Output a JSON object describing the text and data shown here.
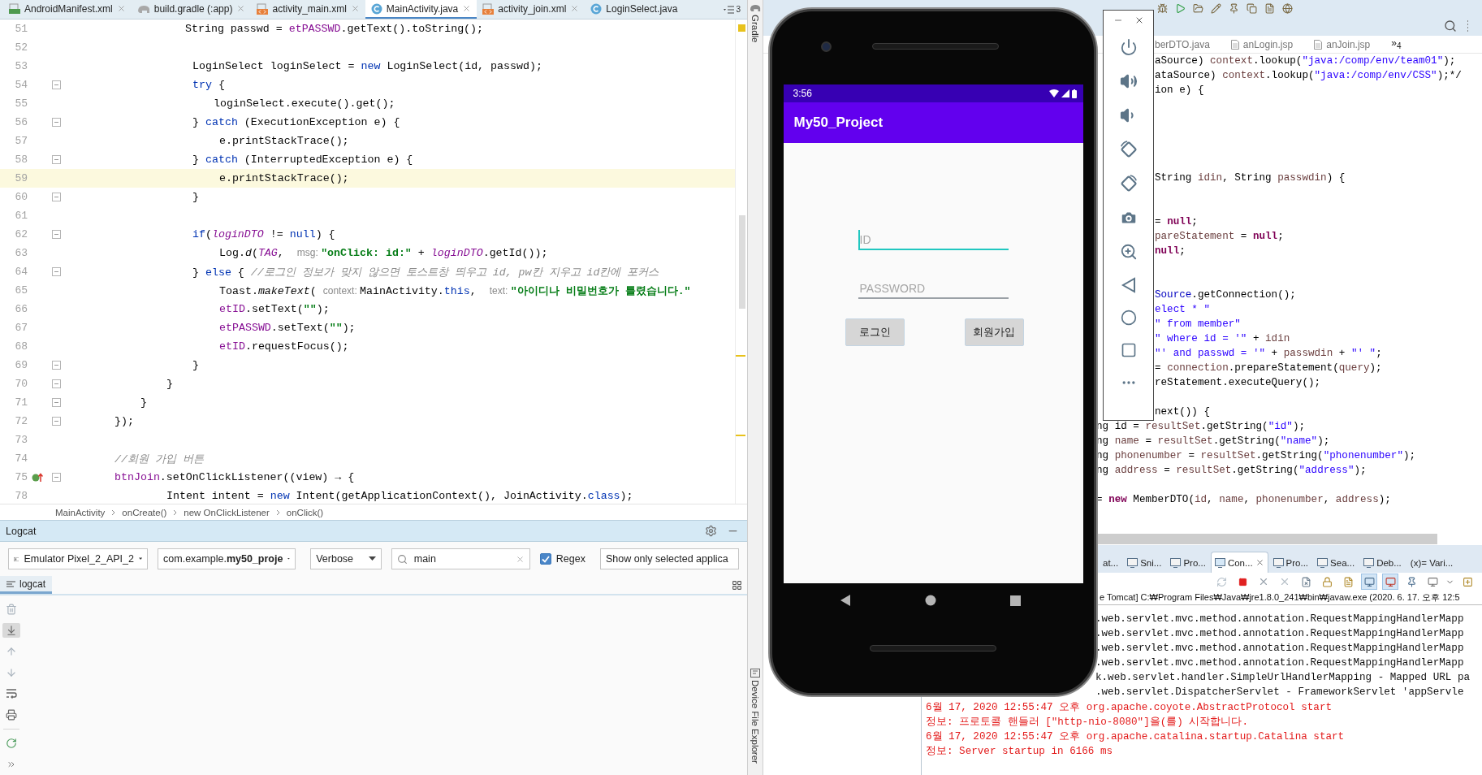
{
  "android_studio": {
    "tabs": [
      {
        "kind": "manifest",
        "label": "AndroidManifest.xml",
        "selected": false,
        "close": true
      },
      {
        "kind": "gradle",
        "label": "build.gradle (:app)",
        "selected": false,
        "close": true
      },
      {
        "kind": "xml",
        "label": "activity_main.xml",
        "selected": false,
        "close": true
      },
      {
        "kind": "class",
        "label": "MainActivity.java",
        "selected": true,
        "close": true
      },
      {
        "kind": "xml",
        "label": "activity_join.xml",
        "selected": false,
        "close": true
      },
      {
        "kind": "class",
        "label": "LoginSelect.java",
        "selected": false,
        "close": false
      }
    ],
    "tab_list_count": "3",
    "code_lines": [
      {
        "num": "51",
        "current": false,
        "fold": false,
        "code": [
          {
            "kind": "plain",
            "text": "String passwd = "
          },
          {
            "kind": "field",
            "text": "etPASSWD"
          },
          {
            "kind": "plain",
            "text": ".getText().toString();"
          }
        ]
      },
      {
        "num": "52",
        "current": false,
        "fold": false
      },
      {
        "num": "53",
        "current": false,
        "fold": false,
        "code": [
          {
            "kind": "plain",
            "text": "LoginSelect loginSelect = "
          },
          {
            "kind": "keyword",
            "text": "new"
          },
          {
            "kind": "plain",
            "text": " LoginSelect(id, passwd);"
          }
        ]
      },
      {
        "num": "54",
        "current": false,
        "fold": true,
        "code": [
          {
            "kind": "keyword",
            "text": "try"
          },
          {
            "kind": "plain",
            "text": " {"
          }
        ]
      },
      {
        "num": "55",
        "current": false,
        "fold": false,
        "code": [
          {
            "kind": "plain",
            "text": "loginSelect.execute().get();"
          }
        ]
      },
      {
        "num": "56",
        "current": false,
        "fold": true,
        "code": [
          {
            "kind": "plain",
            "text": "} "
          },
          {
            "kind": "keyword",
            "text": "catch"
          },
          {
            "kind": "plain",
            "text": " (ExecutionException e) {"
          }
        ]
      },
      {
        "num": "57",
        "current": false,
        "fold": false,
        "code": [
          {
            "kind": "plain",
            "text": "e.printStackTrace();"
          }
        ]
      },
      {
        "num": "58",
        "current": false,
        "fold": true,
        "code": [
          {
            "kind": "plain",
            "text": "} "
          },
          {
            "kind": "keyword",
            "text": "catch"
          },
          {
            "kind": "plain",
            "text": " (InterruptedException e) {"
          }
        ]
      },
      {
        "num": "59",
        "current": true,
        "fold": false,
        "code": [
          {
            "kind": "plain",
            "text": "e.printStackTrace();"
          }
        ]
      },
      {
        "num": "60",
        "current": false,
        "fold": true,
        "code": [
          {
            "kind": "plain",
            "text": "}"
          }
        ]
      },
      {
        "num": "61",
        "current": false,
        "fold": false
      },
      {
        "num": "62",
        "current": false,
        "fold": true,
        "code": [
          {
            "kind": "keyword",
            "text": "if"
          },
          {
            "kind": "plain",
            "text": "("
          },
          {
            "kind": "static_field",
            "text": "loginDTO"
          },
          {
            "kind": "plain",
            "text": " != "
          },
          {
            "kind": "keyword",
            "text": "null"
          },
          {
            "kind": "plain",
            "text": ") {"
          }
        ]
      },
      {
        "num": "63",
        "current": false,
        "fold": false,
        "code": [
          {
            "kind": "plain",
            "text": "Log."
          },
          {
            "kind": "static_method",
            "text": "d"
          },
          {
            "kind": "plain",
            "text": "("
          },
          {
            "kind": "static_field",
            "text": "TAG"
          },
          {
            "kind": "plain",
            "text": ",  "
          },
          {
            "kind": "hint",
            "text": "msg: "
          },
          {
            "kind": "string",
            "text": "\"onClick: id:\""
          },
          {
            "kind": "plain",
            "text": " + "
          },
          {
            "kind": "static_field",
            "text": "loginDTO"
          },
          {
            "kind": "plain",
            "text": ".getId());"
          }
        ]
      },
      {
        "num": "64",
        "current": false,
        "fold": true,
        "code": [
          {
            "kind": "plain",
            "text": "} "
          },
          {
            "kind": "keyword",
            "text": "else"
          },
          {
            "kind": "plain",
            "text": " { "
          },
          {
            "kind": "comment",
            "text": "//로그인 정보가 맞지 않으면 토스트창 띄우고 id, pw칸 지우고 id칸에 포커스"
          }
        ]
      },
      {
        "num": "65",
        "current": false,
        "fold": false,
        "code": [
          {
            "kind": "plain",
            "text": "Toast."
          },
          {
            "kind": "static_method",
            "text": "makeText"
          },
          {
            "kind": "plain",
            "text": "( "
          },
          {
            "kind": "hint",
            "text": "context: "
          },
          {
            "kind": "plain",
            "text": "MainActivity."
          },
          {
            "kind": "keyword",
            "text": "this"
          },
          {
            "kind": "plain",
            "text": ",  "
          },
          {
            "kind": "hint",
            "text": "text: "
          },
          {
            "kind": "string",
            "text": "\"아이디나 비밀번호가 틀렸습니다.\""
          }
        ]
      },
      {
        "num": "66",
        "current": false,
        "fold": false,
        "code": [
          {
            "kind": "field",
            "text": "etID"
          },
          {
            "kind": "plain",
            "text": ".setText("
          },
          {
            "kind": "string",
            "text": "\"\""
          },
          {
            "kind": "plain",
            "text": ");"
          }
        ]
      },
      {
        "num": "67",
        "current": false,
        "fold": false,
        "code": [
          {
            "kind": "field",
            "text": "etPASSWD"
          },
          {
            "kind": "plain",
            "text": ".setText("
          },
          {
            "kind": "string",
            "text": "\"\""
          },
          {
            "kind": "plain",
            "text": ");"
          }
        ]
      },
      {
        "num": "68",
        "current": false,
        "fold": false,
        "code": [
          {
            "kind": "field",
            "text": "etID"
          },
          {
            "kind": "plain",
            "text": ".requestFocus();"
          }
        ]
      },
      {
        "num": "69",
        "current": false,
        "fold": true,
        "code": [
          {
            "kind": "plain",
            "text": "}"
          }
        ]
      },
      {
        "num": "70",
        "current": false,
        "fold": true,
        "code": [
          {
            "kind": "plain",
            "text": "}"
          }
        ]
      },
      {
        "num": "71",
        "current": false,
        "fold": true,
        "code": [
          {
            "kind": "plain",
            "text": "}"
          }
        ]
      },
      {
        "num": "72",
        "current": false,
        "fold": true,
        "code": [
          {
            "kind": "plain",
            "text": "});"
          }
        ]
      },
      {
        "num": "73",
        "current": false,
        "fold": false
      },
      {
        "num": "74",
        "current": false,
        "fold": false,
        "code": [
          {
            "kind": "comment",
            "text": "//회원 가입 버튼"
          }
        ]
      },
      {
        "num": "75",
        "current": false,
        "fold": true,
        "override": true,
        "code": [
          {
            "kind": "field",
            "text": "btnJoin"
          },
          {
            "kind": "plain",
            "text": ".setOnClickListener((view) → {"
          }
        ]
      },
      {
        "num": "78",
        "current": false,
        "fold": false,
        "code": [
          {
            "kind": "plain",
            "text": "Intent intent = "
          },
          {
            "kind": "keyword",
            "text": "new"
          },
          {
            "kind": "plain",
            "text": " Intent(getApplicationContext(), JoinActivity."
          },
          {
            "kind": "keyword",
            "text": "class"
          },
          {
            "kind": "plain",
            "text": ");"
          }
        ]
      }
    ],
    "breadcrumb": [
      "MainActivity",
      "onCreate()",
      "new OnClickListener",
      "onClick()"
    ],
    "logcat": {
      "title": "Logcat",
      "device": "Emulator Pixel_2_API_2",
      "package": "com.example.**my50_proje**",
      "level": "Verbose",
      "search": "main",
      "regex": {
        "label": "Regex",
        "checked": true
      },
      "filter": "Show only selected applica",
      "tabs": [
        {
          "label": "logcat",
          "selected": true
        }
      ]
    }
  },
  "side_tools": [
    "Gradle",
    "Device File Explorer"
  ],
  "eclipse": {
    "editor_tabs": [
      "berDTO.java",
      "anLogin.jsp",
      "anJoin.jsp"
    ],
    "tab_overflow": "»$_{4}$",
    "code_lines": [
      [
        {
          "kind": "plain",
          "text": "aSource) "
        },
        {
          "kind": "local",
          "text": "context"
        },
        {
          "kind": "plain",
          "text": ".lookup("
        },
        {
          "kind": "string",
          "text": "\"java:/comp/env/team01\""
        },
        {
          "kind": "plain",
          "text": ");"
        }
      ],
      [
        {
          "kind": "plain",
          "text": "ataSource) "
        },
        {
          "kind": "local",
          "text": "context"
        },
        {
          "kind": "plain",
          "text": ".lookup("
        },
        {
          "kind": "string",
          "text": "\"java:/comp/env/CSS\""
        },
        {
          "kind": "plain",
          "text": ");*/"
        }
      ],
      [
        {
          "kind": "plain",
          "text": "ion e) {"
        }
      ],
      [
        {
          "kind": "plain",
          "text": "String "
        },
        {
          "kind": "local",
          "text": "idin"
        },
        {
          "kind": "plain",
          "text": ", String "
        },
        {
          "kind": "local",
          "text": "passwdin"
        },
        {
          "kind": "plain",
          "text": ") {"
        }
      ],
      [
        {
          "kind": "plain",
          "text": "= "
        },
        {
          "kind": "keyword",
          "text": "null"
        },
        {
          "kind": "plain",
          "text": ";"
        }
      ],
      [
        {
          "kind": "local",
          "text": "pareStatement"
        },
        {
          "kind": "plain",
          "text": " = "
        },
        {
          "kind": "keyword",
          "text": "null"
        },
        {
          "kind": "plain",
          "text": ";"
        }
      ],
      [
        {
          "kind": "keyword",
          "text": "null"
        },
        {
          "kind": "plain",
          "text": ";"
        }
      ],
      [
        {
          "kind": "member",
          "text": "Source"
        },
        {
          "kind": "plain",
          "text": ".getConnection();"
        }
      ],
      [
        {
          "kind": "string",
          "text": "elect * \""
        }
      ],
      [
        {
          "kind": "string",
          "text": "\" from member\""
        }
      ],
      [
        {
          "kind": "string",
          "text": "\" where id = '\""
        },
        {
          "kind": "plain",
          "text": " + "
        },
        {
          "kind": "local",
          "text": "idin"
        }
      ],
      [
        {
          "kind": "string",
          "text": "\"' and passwd = '\""
        },
        {
          "kind": "plain",
          "text": " + "
        },
        {
          "kind": "local",
          "text": "passwdin"
        },
        {
          "kind": "plain",
          "text": " + "
        },
        {
          "kind": "string",
          "text": "\"' \""
        },
        {
          "kind": "plain",
          "text": ";"
        }
      ],
      [
        {
          "kind": "plain",
          "text": "= "
        },
        {
          "kind": "local",
          "text": "connection"
        },
        {
          "kind": "plain",
          "text": ".prepareStatement("
        },
        {
          "kind": "local",
          "text": "query"
        },
        {
          "kind": "plain",
          "text": ");"
        }
      ],
      [
        {
          "kind": "plain",
          "text": "reStatement.executeQuery();"
        }
      ],
      [
        {
          "kind": "plain",
          "text": "next()) {"
        }
      ],
      [
        {
          "kind": "plain",
          "text": "ng id = "
        },
        {
          "kind": "local",
          "text": "resultSet"
        },
        {
          "kind": "plain",
          "text": ".getString("
        },
        {
          "kind": "string",
          "text": "\"id\""
        },
        {
          "kind": "plain",
          "text": ");"
        }
      ],
      [
        {
          "kind": "plain",
          "text": "ng "
        },
        {
          "kind": "local",
          "text": "name"
        },
        {
          "kind": "plain",
          "text": " = "
        },
        {
          "kind": "local",
          "text": "resultSet"
        },
        {
          "kind": "plain",
          "text": ".getString("
        },
        {
          "kind": "string",
          "text": "\"name\""
        },
        {
          "kind": "plain",
          "text": ");"
        }
      ],
      [
        {
          "kind": "plain",
          "text": "ng "
        },
        {
          "kind": "local",
          "text": "phonenumber"
        },
        {
          "kind": "plain",
          "text": " = "
        },
        {
          "kind": "local",
          "text": "resultSet"
        },
        {
          "kind": "plain",
          "text": ".getString("
        },
        {
          "kind": "string",
          "text": "\"phonenumber\""
        },
        {
          "kind": "plain",
          "text": ");"
        }
      ],
      [
        {
          "kind": "plain",
          "text": "ng "
        },
        {
          "kind": "local",
          "text": "address"
        },
        {
          "kind": "plain",
          "text": " = "
        },
        {
          "kind": "local",
          "text": "resultSet"
        },
        {
          "kind": "plain",
          "text": ".getString("
        },
        {
          "kind": "string",
          "text": "\"address\""
        },
        {
          "kind": "plain",
          "text": ");"
        }
      ],
      [
        {
          "kind": "plain",
          "text": "= "
        },
        {
          "kind": "keyword",
          "text": "new"
        },
        {
          "kind": "plain",
          "text": " MemberDTO("
        },
        {
          "kind": "local",
          "text": "id"
        },
        {
          "kind": "plain",
          "text": ", "
        },
        {
          "kind": "local",
          "text": "name"
        },
        {
          "kind": "plain",
          "text": ", "
        },
        {
          "kind": "local",
          "text": "phonenumber"
        },
        {
          "kind": "plain",
          "text": ", "
        },
        {
          "kind": "local",
          "text": "address"
        },
        {
          "kind": "plain",
          "text": ");"
        }
      ]
    ],
    "console": {
      "tabs": [
        {
          "label": "at...",
          "icon": false,
          "selected": false
        },
        {
          "label": "Sni...",
          "icon": true,
          "selected": false
        },
        {
          "label": "Pro...",
          "icon": true,
          "selected": false
        },
        {
          "label": "Con...",
          "icon": true,
          "selected": true
        },
        {
          "label": "Pro...",
          "icon": true,
          "selected": false
        },
        {
          "label": "Sea...",
          "icon": true,
          "selected": false
        },
        {
          "label": "Deb...",
          "icon": true,
          "selected": false
        },
        {
          "label": "(x)= Vari...",
          "icon": false,
          "selected": false
        }
      ],
      "path": "e Tomcat] C:₩Program Files₩Java₩jre1.8.0_241₩bin₩javaw.exe  (2020. 6. 17. 오후 12:5",
      "lines": [
        {
          "kind": "out",
          "text": ".web.servlet.mvc.method.annotation.RequestMappingHandlerMapp"
        },
        {
          "kind": "out",
          "text": ".web.servlet.mvc.method.annotation.RequestMappingHandlerMapp"
        },
        {
          "kind": "out",
          "text": ".web.servlet.mvc.method.annotation.RequestMappingHandlerMapp"
        },
        {
          "kind": "out",
          "text": ".web.servlet.mvc.method.annotation.RequestMappingHandlerMapp"
        },
        {
          "kind": "out",
          "text": "k.web.servlet.handler.SimpleUrlHandlerMapping - Mapped URL pa"
        },
        {
          "kind": "out",
          "text": ".web.servlet.DispatcherServlet - FrameworkServlet 'appServle"
        },
        {
          "kind": "err",
          "text": "6월 17, 2020 12:55:47 오후 org.apache.coyote.AbstractProtocol start"
        },
        {
          "kind": "err",
          "text": "정보: 프로토콜 핸들러 [\"http-nio-8080\"]을(를) 시작합니다."
        },
        {
          "kind": "err",
          "text": "6월 17, 2020 12:55:47 오후 org.apache.catalina.startup.Catalina start"
        },
        {
          "kind": "err",
          "text": "정보: Server startup in 6166 ms"
        }
      ]
    }
  },
  "emulator": {
    "status_time": "3:56",
    "app_title": "My50_Project",
    "fields": [
      {
        "placeholder": "ID",
        "focused": true
      },
      {
        "placeholder": "PASSWORD",
        "focused": false
      }
    ],
    "buttons": [
      "로그인",
      "회원가입"
    ]
  }
}
